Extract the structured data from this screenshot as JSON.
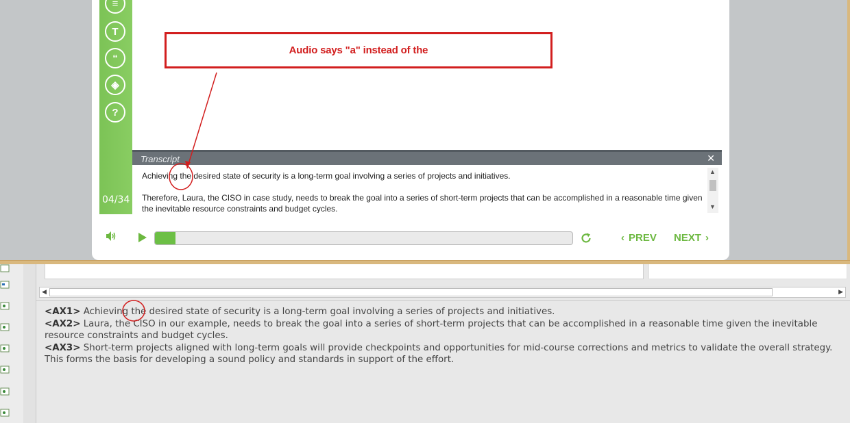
{
  "player": {
    "page_counter": "04/34",
    "sidebar_icons": [
      "list-icon",
      "text-icon",
      "quote-icon",
      "layers-icon",
      "help-icon"
    ],
    "sidebar_glyphs": [
      "≡",
      "T",
      "“",
      "◈",
      "?"
    ],
    "transcript": {
      "title": "Transcript",
      "close_glyph": "✕",
      "paragraph_1": "Achieving the desired state of security is a long-term goal involving a series of projects and initiatives.",
      "paragraph_2": "Therefore, Laura, the CISO in case study, needs to break the goal into a series of short-term projects that can be accomplished in a reasonable time given the inevitable resource constraints and budget cycles."
    },
    "controls": {
      "progress_fraction": 0.05,
      "prev_label": "PREV",
      "next_label": "NEXT"
    },
    "accent_color": "#6cbf45"
  },
  "annotation": {
    "callout_text": "Audio says \"a\" instead of the",
    "color": "#d21e1e"
  },
  "editor": {
    "script_lines": [
      {
        "tag": "<AX1>",
        "text": " Achieving the desired state of security is a long-term goal involving a series of projects and initiatives."
      },
      {
        "tag": "<AX2>",
        "text": " Laura, the CISO in our example, needs to break the goal into a series of short-term projects that can be accomplished in a reasonable time given the inevitable resource constraints and budget cycles."
      },
      {
        "tag": "<AX3>",
        "text": " Short-term projects aligned with long-term goals will provide checkpoints and opportunities for mid-course corrections and metrics to validate the overall strategy. This forms the basis for developing a sound policy and standards in support of the effort."
      }
    ]
  }
}
